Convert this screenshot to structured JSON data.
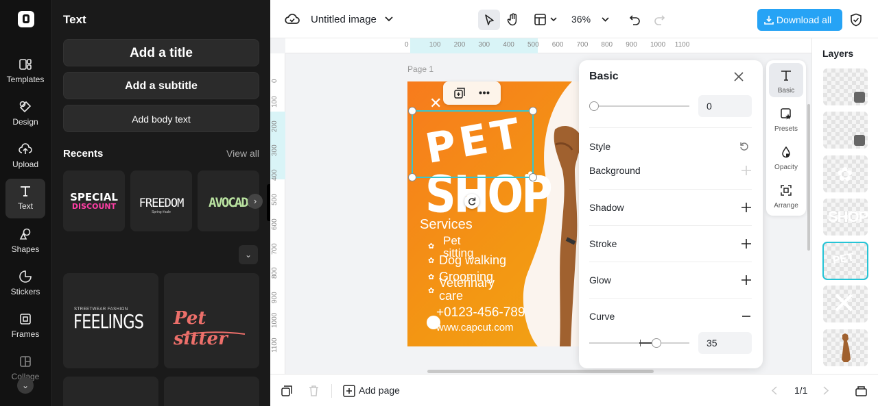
{
  "app": {
    "document_name": "Untitled image",
    "zoom": "36%",
    "download_label": "Download all",
    "accent_color": "#26a3f5"
  },
  "rail": {
    "items": [
      {
        "label": "Templates",
        "icon": "templates-icon"
      },
      {
        "label": "Design",
        "icon": "design-icon"
      },
      {
        "label": "Upload",
        "icon": "upload-icon"
      },
      {
        "label": "Text",
        "icon": "text-icon",
        "active": true
      },
      {
        "label": "Shapes",
        "icon": "shapes-icon"
      },
      {
        "label": "Stickers",
        "icon": "stickers-icon"
      },
      {
        "label": "Frames",
        "icon": "frames-icon"
      },
      {
        "label": "Collage",
        "icon": "collage-icon"
      }
    ]
  },
  "text_panel": {
    "title": "Text",
    "add_title": "Add a title",
    "add_subtitle": "Add a subtitle",
    "add_body": "Add body text",
    "recents_label": "Recents",
    "view_all": "View all",
    "recents": [
      {
        "line1": "SPECIAL",
        "line2": "DISCOUNT"
      },
      {
        "line1": "FREEDOM",
        "line2": "Spring #sale"
      },
      {
        "line1": "AVOCADO",
        "line2": ""
      }
    ],
    "templates": [
      {
        "small": "STREETWEAR FASHION",
        "big": "FEELINGS"
      },
      {
        "big": "Pet sitter"
      }
    ]
  },
  "ruler": {
    "h_ticks": [
      "0",
      "100",
      "200",
      "300",
      "400",
      "500",
      "600",
      "700",
      "800",
      "900",
      "1000",
      "1100"
    ],
    "v_ticks": [
      "0",
      "100",
      "200",
      "300",
      "400",
      "500",
      "600",
      "700",
      "800",
      "900",
      "1000",
      "1100"
    ]
  },
  "canvas": {
    "page_label": "Page 1",
    "poster": {
      "word1": "PET",
      "word2": "SHOP",
      "services_heading": "Services",
      "services": [
        "Pet sitting",
        "Dog walking",
        "Grooming",
        "Veterinary care"
      ],
      "phone": "+0123-456-789",
      "website": "www.capcut.com"
    }
  },
  "props": {
    "title": "Basic",
    "top_value": "0",
    "style_label": "Style",
    "rows": [
      {
        "label": "Background",
        "control": "add",
        "enabled": false
      },
      {
        "label": "Shadow",
        "control": "add",
        "enabled": true
      },
      {
        "label": "Stroke",
        "control": "add",
        "enabled": true
      },
      {
        "label": "Glow",
        "control": "add",
        "enabled": true
      },
      {
        "label": "Curve",
        "control": "collapse",
        "enabled": true
      }
    ],
    "curve_value": "35",
    "top_slider_level": 0.0,
    "curve_slider_level": 0.67
  },
  "prop_tabs": [
    {
      "label": "Basic",
      "icon": "text-icon",
      "active": true
    },
    {
      "label": "Presets",
      "icon": "presets-icon"
    },
    {
      "label": "Opacity",
      "icon": "opacity-icon"
    },
    {
      "label": "Arrange",
      "icon": "arrange-icon"
    }
  ],
  "layers": {
    "title": "Layers",
    "items": [
      "background-layer",
      "pattern-layer",
      "paw-layer",
      "shop-text-layer",
      "pet-text-layer",
      "logo-layer",
      "dog-photo-layer"
    ],
    "selected_index": 4
  },
  "bottom": {
    "add_page": "Add page",
    "page_counter": "1/1"
  }
}
